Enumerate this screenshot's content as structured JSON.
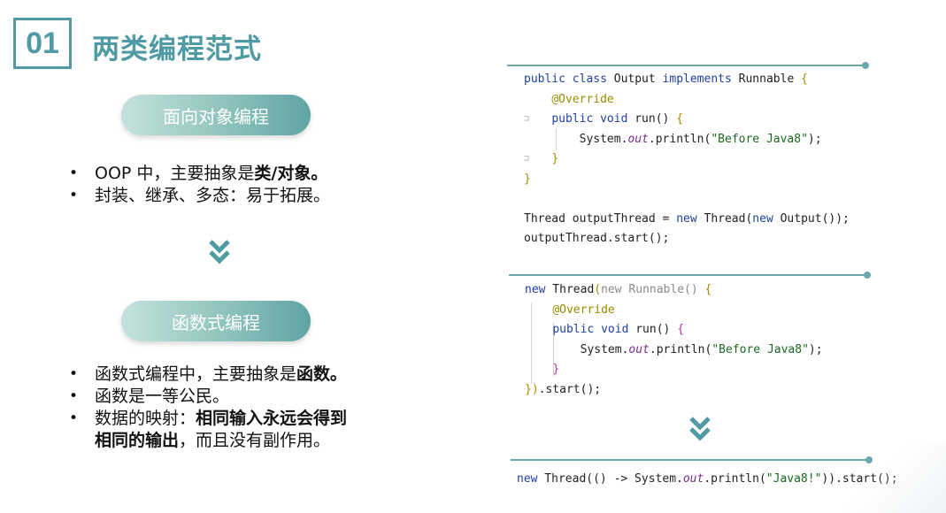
{
  "section": {
    "number": "01",
    "title": "两类编程范式"
  },
  "oop": {
    "pill_label": "面向对象编程",
    "bullets": [
      {
        "text": "OOP 中，主要抽象是",
        "bold": "类/对象。",
        "after": ""
      },
      {
        "text": "封装、继承、多态：易于拓展。",
        "bold": "",
        "after": ""
      }
    ]
  },
  "fp": {
    "pill_label": "函数式编程",
    "bullets": [
      {
        "text": "函数式编程中，主要抽象是",
        "bold": "函数。",
        "after": ""
      },
      {
        "text": "函数是一等公民。",
        "bold": "",
        "after": ""
      },
      {
        "text": "数据的映射：",
        "bold": "相同输入永远会得到",
        "after": ""
      }
    ],
    "bullet3_line2_bold": "相同的输出",
    "bullet3_line2_rest": "，而且没有副作用。"
  },
  "colors": {
    "accent": "#4f9aa3",
    "rule": "#6aa8ae"
  },
  "icons": {
    "chevron": "double-chevron-down-icon",
    "fold": "fold-marker-icon"
  },
  "code": {
    "block1": [
      "public class Output implements Runnable {",
      "    @Override",
      "    public void run() {",
      "        System.out.println(\"Before Java8\");",
      "    }",
      "}",
      "",
      "Thread outputThread = new Thread(new Output());",
      "outputThread.start();"
    ],
    "block2": [
      "new Thread(new Runnable() {",
      "    @Override",
      "    public void run() {",
      "        System.out.println(\"Before Java8\");",
      "    }",
      "}).start();"
    ],
    "block3": [
      "new Thread(() -> System.out.println(\"Java8!\")).start();"
    ]
  }
}
